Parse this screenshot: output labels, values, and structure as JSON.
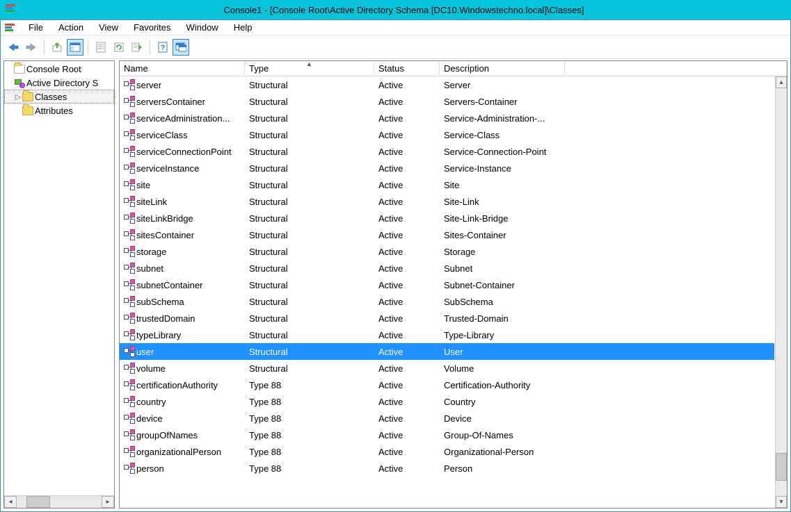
{
  "window": {
    "title": "Console1 - [Console Root\\Active Directory Schema [DC10.Windowstechno.local]\\Classes]"
  },
  "menubar": [
    "File",
    "Action",
    "View",
    "Favorites",
    "Window",
    "Help"
  ],
  "tree": {
    "root": "Console Root",
    "schema_node": "Active Directory S",
    "classes": "Classes",
    "attributes": "Attributes"
  },
  "list": {
    "columns": {
      "name": "Name",
      "type": "Type",
      "status": "Status",
      "description": "Description"
    },
    "sorted_column": "type",
    "rows": [
      {
        "name": "server",
        "type": "Structural",
        "status": "Active",
        "desc": "Server",
        "selected": false
      },
      {
        "name": "serversContainer",
        "type": "Structural",
        "status": "Active",
        "desc": "Servers-Container",
        "selected": false
      },
      {
        "name": "serviceAdministration...",
        "type": "Structural",
        "status": "Active",
        "desc": "Service-Administration-...",
        "selected": false
      },
      {
        "name": "serviceClass",
        "type": "Structural",
        "status": "Active",
        "desc": "Service-Class",
        "selected": false
      },
      {
        "name": "serviceConnectionPoint",
        "type": "Structural",
        "status": "Active",
        "desc": "Service-Connection-Point",
        "selected": false
      },
      {
        "name": "serviceInstance",
        "type": "Structural",
        "status": "Active",
        "desc": "Service-Instance",
        "selected": false
      },
      {
        "name": "site",
        "type": "Structural",
        "status": "Active",
        "desc": "Site",
        "selected": false
      },
      {
        "name": "siteLink",
        "type": "Structural",
        "status": "Active",
        "desc": "Site-Link",
        "selected": false
      },
      {
        "name": "siteLinkBridge",
        "type": "Structural",
        "status": "Active",
        "desc": "Site-Link-Bridge",
        "selected": false
      },
      {
        "name": "sitesContainer",
        "type": "Structural",
        "status": "Active",
        "desc": "Sites-Container",
        "selected": false
      },
      {
        "name": "storage",
        "type": "Structural",
        "status": "Active",
        "desc": "Storage",
        "selected": false
      },
      {
        "name": "subnet",
        "type": "Structural",
        "status": "Active",
        "desc": "Subnet",
        "selected": false
      },
      {
        "name": "subnetContainer",
        "type": "Structural",
        "status": "Active",
        "desc": "Subnet-Container",
        "selected": false
      },
      {
        "name": "subSchema",
        "type": "Structural",
        "status": "Active",
        "desc": "SubSchema",
        "selected": false
      },
      {
        "name": "trustedDomain",
        "type": "Structural",
        "status": "Active",
        "desc": "Trusted-Domain",
        "selected": false
      },
      {
        "name": "typeLibrary",
        "type": "Structural",
        "status": "Active",
        "desc": "Type-Library",
        "selected": false
      },
      {
        "name": "user",
        "type": "Structural",
        "status": "Active",
        "desc": "User",
        "selected": true
      },
      {
        "name": "volume",
        "type": "Structural",
        "status": "Active",
        "desc": "Volume",
        "selected": false
      },
      {
        "name": "certificationAuthority",
        "type": "Type 88",
        "status": "Active",
        "desc": "Certification-Authority",
        "selected": false
      },
      {
        "name": "country",
        "type": "Type 88",
        "status": "Active",
        "desc": "Country",
        "selected": false
      },
      {
        "name": "device",
        "type": "Type 88",
        "status": "Active",
        "desc": "Device",
        "selected": false
      },
      {
        "name": "groupOfNames",
        "type": "Type 88",
        "status": "Active",
        "desc": "Group-Of-Names",
        "selected": false
      },
      {
        "name": "organizationalPerson",
        "type": "Type 88",
        "status": "Active",
        "desc": "Organizational-Person",
        "selected": false
      },
      {
        "name": "person",
        "type": "Type 88",
        "status": "Active",
        "desc": "Person",
        "selected": false
      }
    ]
  }
}
